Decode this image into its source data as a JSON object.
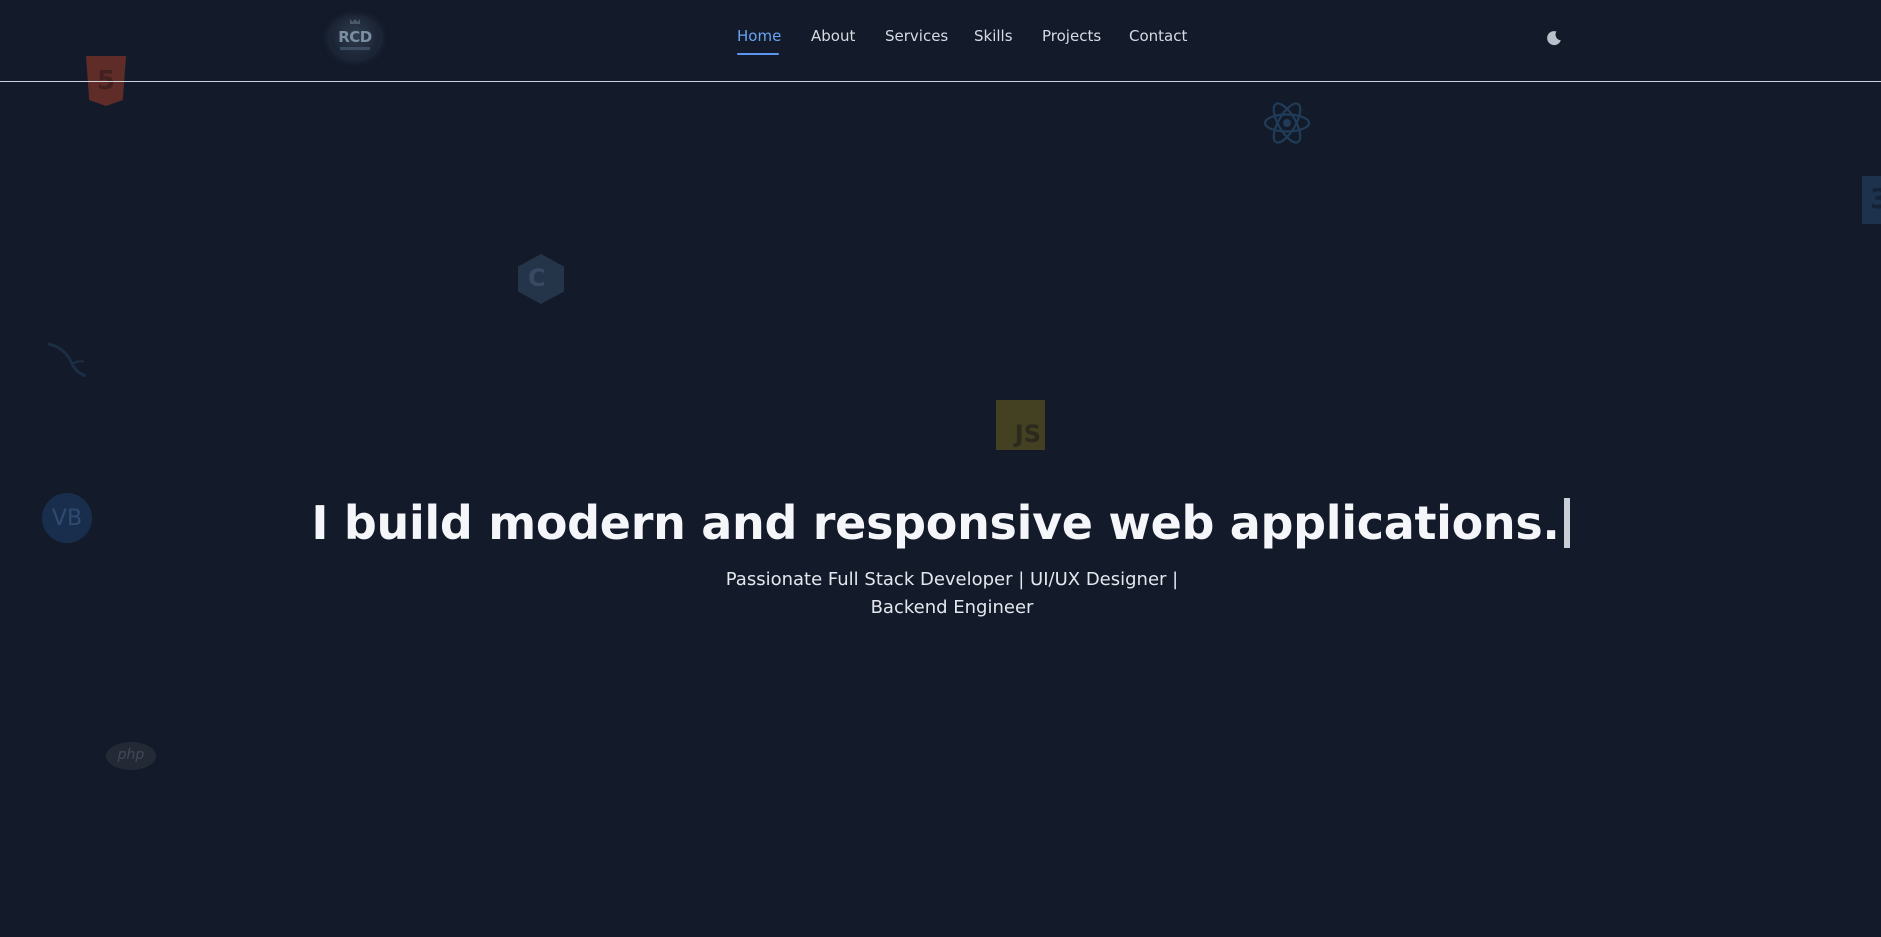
{
  "header": {
    "logo_text": "RCD",
    "nav": [
      {
        "label": "Home",
        "active": true
      },
      {
        "label": "About",
        "active": false
      },
      {
        "label": "Services",
        "active": false
      },
      {
        "label": "Skills",
        "active": false
      },
      {
        "label": "Projects",
        "active": false
      },
      {
        "label": "Contact",
        "active": false
      }
    ],
    "theme_toggle_icon": "moon-icon"
  },
  "background_icons": [
    {
      "name": "html5-icon",
      "text": "5"
    },
    {
      "name": "react-icon"
    },
    {
      "name": "css3-icon",
      "text": "3"
    },
    {
      "name": "cpp-icon",
      "text": "C"
    },
    {
      "name": "mysql-icon"
    },
    {
      "name": "javascript-icon",
      "text": "JS"
    },
    {
      "name": "visual-basic-icon",
      "text": "VB"
    },
    {
      "name": "php-icon",
      "text": "php"
    }
  ],
  "hero": {
    "title": "I build modern and responsive web applications.",
    "subtitle": "Passionate Full Stack Developer | UI/UX Designer | Backend Engineer"
  },
  "colors": {
    "background": "#131a29",
    "accent": "#6aa3f5",
    "text": "#f4f6fa"
  }
}
